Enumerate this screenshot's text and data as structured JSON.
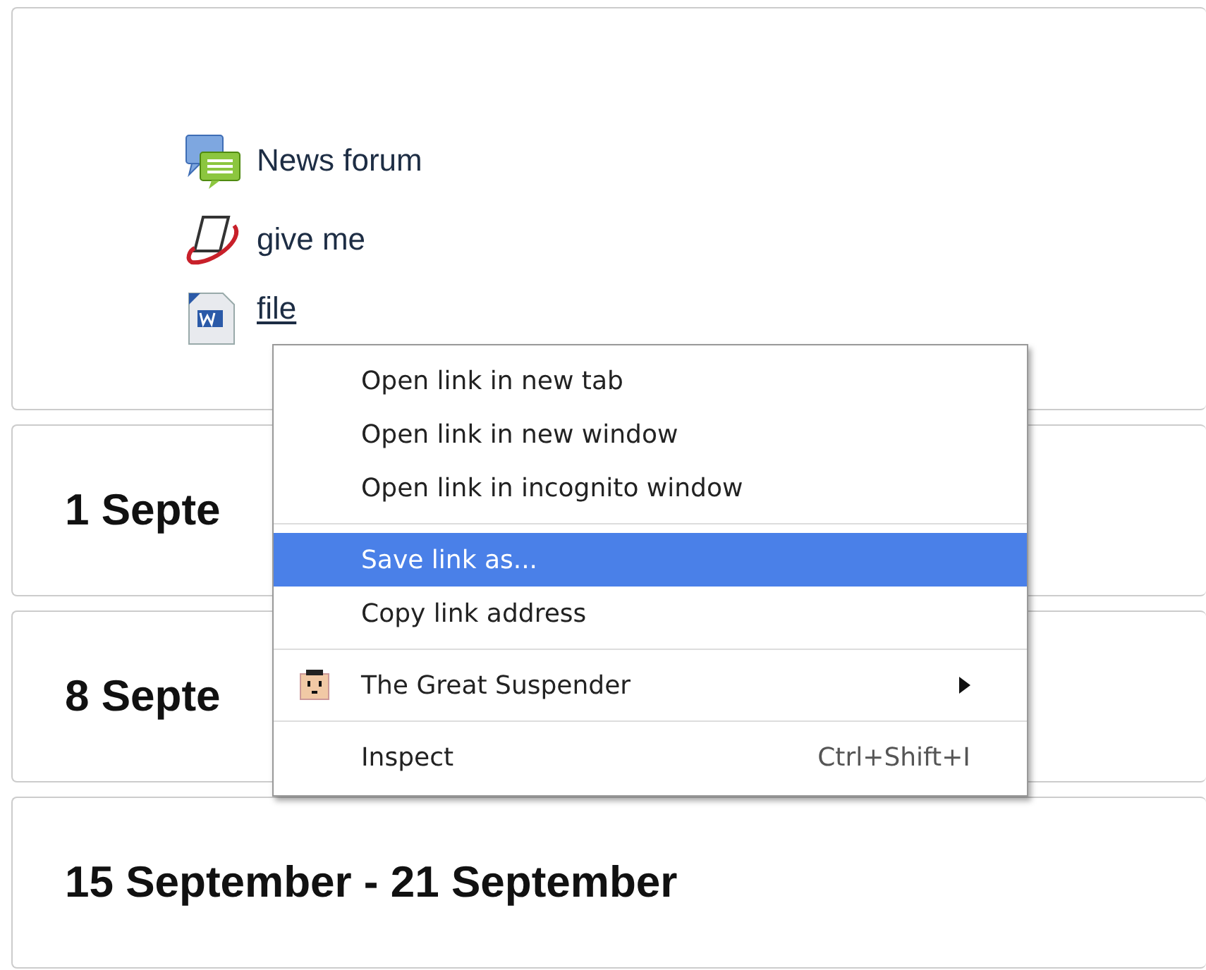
{
  "activities": [
    {
      "kind": "forum",
      "label": "News forum"
    },
    {
      "kind": "assignment",
      "label": "give me"
    },
    {
      "kind": "word",
      "label": "file"
    }
  ],
  "weeks": [
    {
      "title": "1 Septe"
    },
    {
      "title": "8 Septe"
    },
    {
      "title": "15 September - 21 September"
    }
  ],
  "context_menu": {
    "groups": [
      [
        {
          "label": "Open link in new tab",
          "selected": false
        },
        {
          "label": "Open link in new window",
          "selected": false
        },
        {
          "label": "Open link in incognito window",
          "selected": false
        }
      ],
      [
        {
          "label": "Save link as...",
          "selected": true
        },
        {
          "label": "Copy link address",
          "selected": false
        }
      ],
      [
        {
          "label": "The Great Suspender",
          "selected": false,
          "kind": "extension",
          "submenu": true
        }
      ],
      [
        {
          "label": "Inspect",
          "selected": false,
          "shortcut": "Ctrl+Shift+I"
        }
      ]
    ]
  }
}
